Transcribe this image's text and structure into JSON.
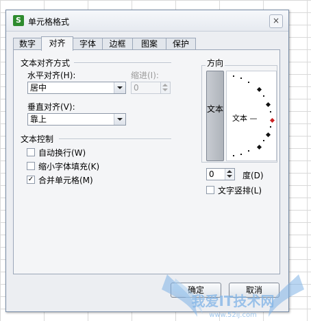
{
  "window": {
    "title": "单元格格式",
    "app_icon": "S",
    "close_glyph": "×"
  },
  "tabs": [
    {
      "label": "数字",
      "active": false
    },
    {
      "label": "对齐",
      "active": true
    },
    {
      "label": "字体",
      "active": false
    },
    {
      "label": "边框",
      "active": false
    },
    {
      "label": "图案",
      "active": false
    },
    {
      "label": "保护",
      "active": false
    }
  ],
  "alignment": {
    "group_title": "文本对齐方式",
    "horizontal_label": "水平对齐(H):",
    "horizontal_value": "居中",
    "indent_label": "缩进(I):",
    "indent_value": "0",
    "vertical_label": "垂直对齐(V):",
    "vertical_value": "靠上"
  },
  "text_control": {
    "group_title": "文本控制",
    "wrap": {
      "label": "自动换行(W)",
      "checked": false
    },
    "shrink": {
      "label": "缩小字体填充(K)",
      "checked": false
    },
    "merge": {
      "label": "合并单元格(M)",
      "checked": true,
      "mark": "✓"
    }
  },
  "orientation": {
    "group_title": "方向",
    "vertical_text": "文本",
    "dial_label": "文本 —",
    "degree_value": "0",
    "degree_label": "度(D)",
    "vertical_layout": {
      "label": "文字竖排(L)",
      "checked": false
    }
  },
  "buttons": {
    "ok": "确定",
    "cancel": "取消"
  },
  "watermark": {
    "text": "我爱IT技术网",
    "url": "www.52ij.com"
  },
  "colors": {
    "dial_marker": "#cc2222",
    "app_icon": "#2e8b2e",
    "watermark": "#7fb3e6"
  }
}
